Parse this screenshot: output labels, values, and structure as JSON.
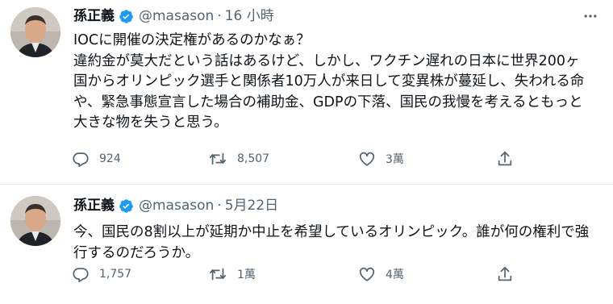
{
  "colors": {
    "text": "#0f1419",
    "secondary": "#536471",
    "verified": "#1d9bf0",
    "divider": "#e6ecf0"
  },
  "tweets": [
    {
      "name": "孫正義",
      "handle": "@masason",
      "separator": "·",
      "time": "16 小時",
      "text": "IOCに開催の決定権があるのかなぁ？\n違約金が莫大だという話はあるけど、しかし、ワクチン遅れの日本に世界200ヶ国からオリンピック選手と関係者10万人が来日して変異株が蔓延し、失われる命や、緊急事態宣言した場合の補助金、GDPの下落、国民の我慢を考えるともっと大きな物を失うと思う。",
      "replies": "924",
      "retweets": "8,507",
      "likes": "3萬",
      "icons": [
        "verified-badge-icon",
        "more-icon",
        "reply-icon",
        "retweet-icon",
        "like-icon",
        "share-icon"
      ]
    },
    {
      "name": "孫正義",
      "handle": "@masason",
      "separator": "·",
      "time": "5月22日",
      "text": "今、国民の8割以上が延期か中止を希望しているオリンピック。誰が何の権利で強行するのだろうか。",
      "replies": "1,757",
      "retweets": "1萬",
      "likes": "4萬",
      "icons": [
        "verified-badge-icon",
        "reply-icon",
        "retweet-icon",
        "like-icon",
        "share-icon"
      ]
    }
  ]
}
